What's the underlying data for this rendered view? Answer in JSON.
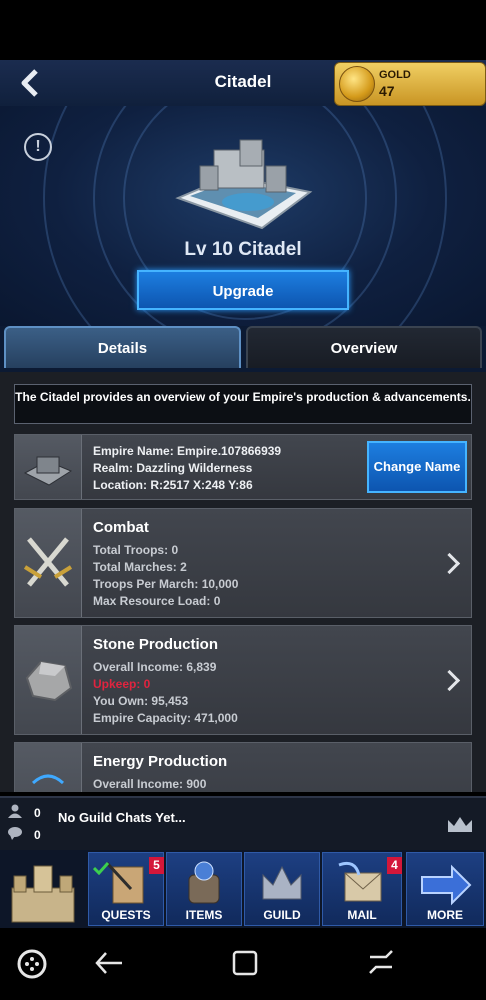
{
  "header": {
    "title": "Citadel"
  },
  "gold": {
    "label": "GOLD",
    "value": "47"
  },
  "hero": {
    "level_title": "Lv 10 Citadel",
    "upgrade_label": "Upgrade"
  },
  "tabs": [
    {
      "label": "Details",
      "active": true
    },
    {
      "label": "Overview",
      "active": false
    }
  ],
  "description": "The Citadel provides an overview of your Empire's production & advancements.",
  "empire": {
    "name_line": "Empire Name: Empire.107866939",
    "realm_line": "Realm: Dazzling Wilderness",
    "location_line": "Location: R:2517 X:248 Y:86",
    "change_name_label": "Change Name"
  },
  "combat": {
    "title": "Combat",
    "lines": [
      "Total Troops: 0",
      "Total Marches: 2",
      "Troops Per March: 10,000",
      "Max Resource Load: 0"
    ]
  },
  "stone": {
    "title": "Stone Production",
    "income": "Overall Income: 6,839",
    "upkeep": "Upkeep: 0",
    "own": "You Own: 95,453",
    "capacity": "Empire Capacity: 471,000"
  },
  "energy": {
    "title": "Energy Production",
    "income": "Overall Income: 900"
  },
  "chat": {
    "users_count": "0",
    "messages_count": "0",
    "text": "No Guild Chats Yet..."
  },
  "nav": {
    "quests_label": "QUESTS",
    "quests_badge": "5",
    "items_label": "ITEMS",
    "guild_label": "GUILD",
    "mail_label": "MAIL",
    "mail_badge": "4",
    "more_label": "MORE"
  },
  "colors": {
    "accent_blue": "#1d7ee0",
    "gold": "#f0cf63",
    "upkeep_red": "#e0243f",
    "badge_red": "#d4173a"
  }
}
